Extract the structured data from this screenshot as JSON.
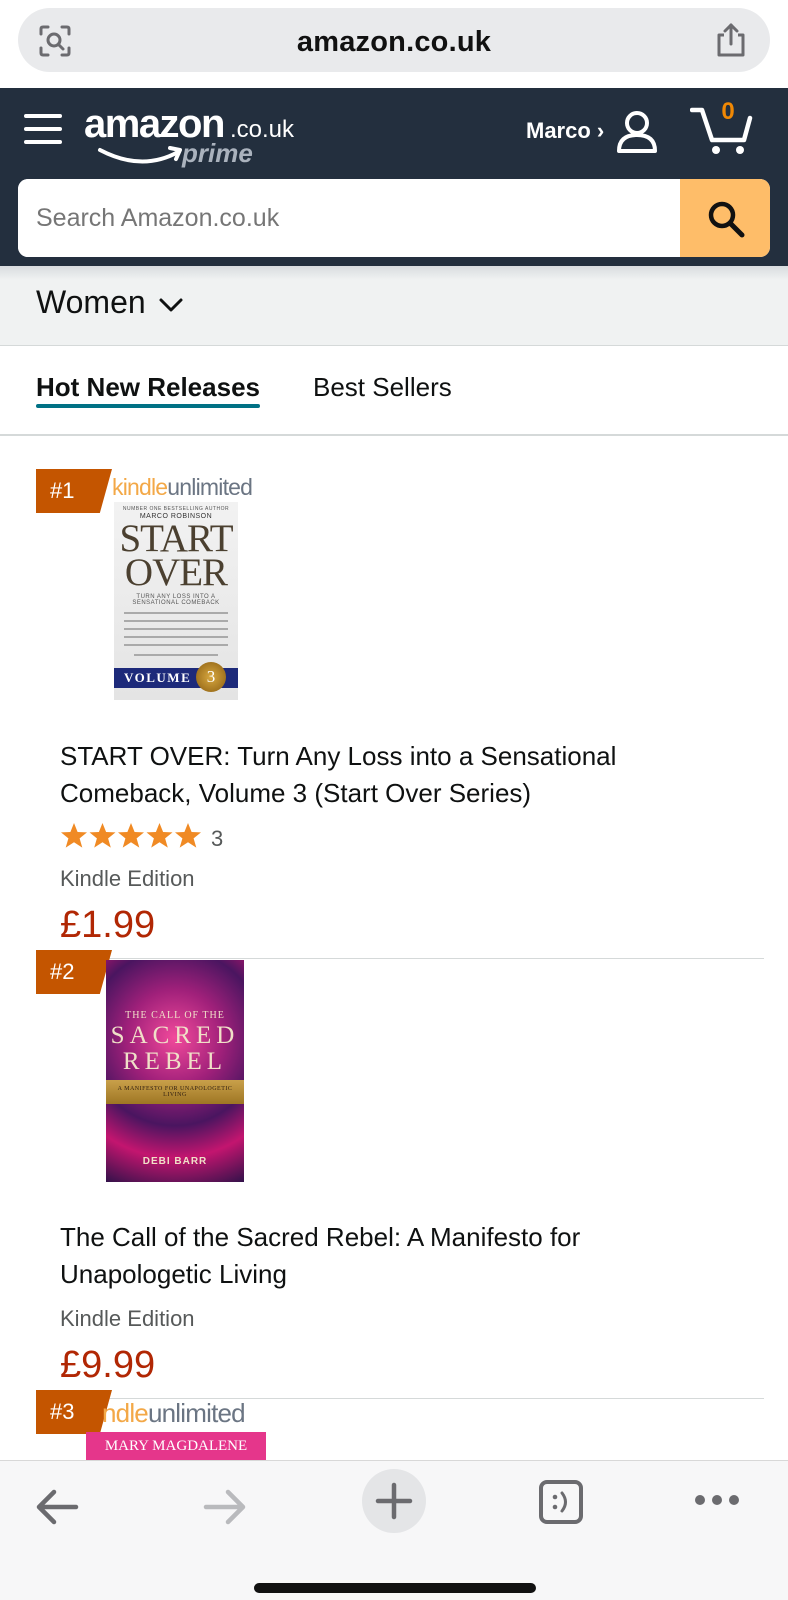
{
  "browser": {
    "url": "amazon.co.uk",
    "icons": {
      "left": "screenshot-search-icon",
      "right": "share-icon"
    }
  },
  "header": {
    "logo_main": "amazon",
    "logo_tld": ".co.uk",
    "logo_prime": "prime",
    "account_label": "Marco ›",
    "cart_count": "0",
    "colors": {
      "background": "#232f3e",
      "search_button": "#febd69",
      "cart_count": "#f08804"
    }
  },
  "search": {
    "placeholder": "Search Amazon.co.uk",
    "value": ""
  },
  "category": {
    "selected": "Women"
  },
  "tabs": [
    {
      "label": "Hot New Releases",
      "active": true
    },
    {
      "label": "Best Sellers",
      "active": false
    }
  ],
  "products": [
    {
      "rank": "#1",
      "badge": {
        "kindle": "kindle",
        "unlimited": "unlimited"
      },
      "cover": {
        "top_line": "NUMBER ONE BESTSELLING AUTHOR",
        "author_line": "MARCO ROBINSON",
        "title_lines": [
          "START",
          "OVER"
        ],
        "subtitle": "TURN ANY LOSS INTO A SENSATIONAL COMEBACK",
        "volume": "VOLUME",
        "volume_num": "3"
      },
      "title": "START OVER: Turn Any Loss into a Sensational Comeback, Volume 3 (Start Over Series)",
      "rating": 5,
      "rating_count": "3",
      "format": "Kindle Edition",
      "price": "£1.99"
    },
    {
      "rank": "#2",
      "cover": {
        "line1": "THE CALL OF THE",
        "line2": "SACRED",
        "line3": "REBEL",
        "tagline": "A MANIFESTO FOR UNAPOLOGETIC LIVING",
        "author": "DEBI BARR"
      },
      "title": "The Call of the Sacred Rebel: A Manifesto for Unapologetic Living",
      "format": "Kindle Edition",
      "price": "£9.99"
    },
    {
      "rank": "#3",
      "badge": {
        "kindle": "ndle",
        "unlimited": "unlimited"
      },
      "cover": {
        "line1": "MARY MAGDALENE"
      }
    }
  ],
  "toolbar": {
    "icons": [
      "back-arrow-icon",
      "forward-arrow-icon",
      "new-tab-plus-icon",
      "tabs-switcher-icon",
      "more-dots-icon"
    ]
  }
}
